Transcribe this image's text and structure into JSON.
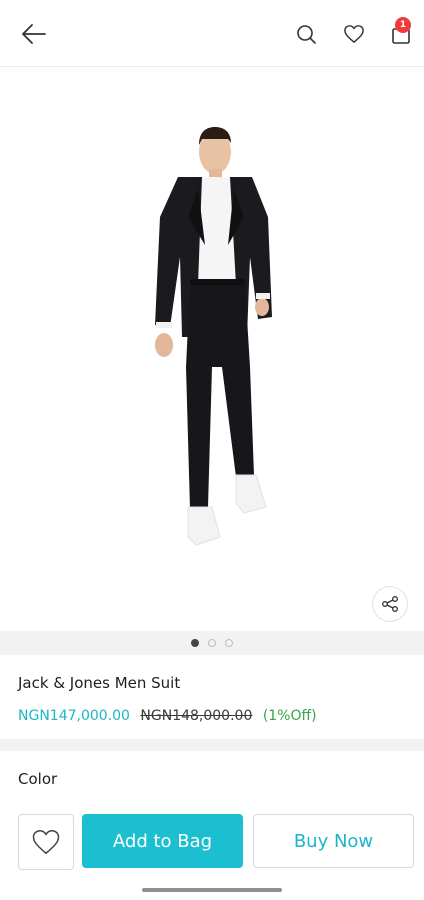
{
  "header": {
    "icons": [
      "back-arrow-icon",
      "search-icon",
      "heart-icon",
      "shopping-bag-icon"
    ],
    "cart_badge": "1"
  },
  "product": {
    "image": "men-suit-photo",
    "name": "Jack & Jones Men Suit",
    "price": "NGN147,000.00",
    "old_price": "NGN148,000.00",
    "discount": "(1%Off)"
  },
  "carousel": {
    "count": 3,
    "active_index": 0
  },
  "options": {
    "color_label": "Color"
  },
  "actions": {
    "add_to_bag": "Add to Bag",
    "buy_now": "Buy Now"
  },
  "colors": {
    "accent": "#1cbfcf",
    "discount": "#3aa64b",
    "badge": "#ef3b3b"
  }
}
